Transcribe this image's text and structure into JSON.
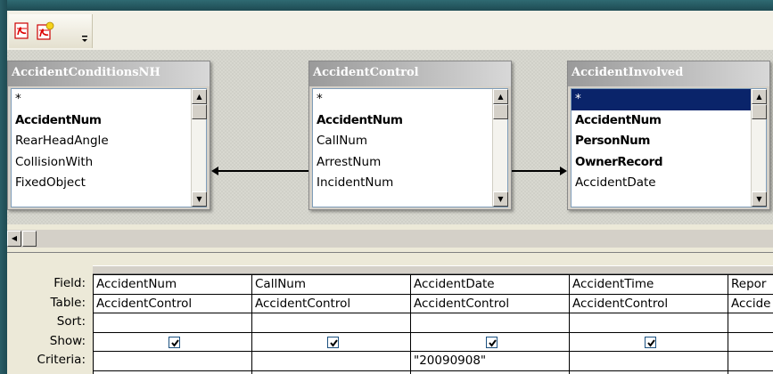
{
  "toolbar": {
    "buttons": [
      {
        "icon": "pdf-export-icon"
      },
      {
        "icon": "pdf-export-options-icon"
      }
    ],
    "overflow_icon": "toolbar-overflow-icon"
  },
  "tables": [
    {
      "title": "AccidentConditionsNH",
      "fields": [
        {
          "name": "*",
          "bold": false
        },
        {
          "name": "AccidentNum",
          "bold": true
        },
        {
          "name": "RearHeadAngle",
          "bold": false
        },
        {
          "name": "CollisionWith",
          "bold": false
        },
        {
          "name": "FixedObject",
          "bold": false
        }
      ]
    },
    {
      "title": "AccidentControl",
      "fields": [
        {
          "name": "*",
          "bold": false
        },
        {
          "name": "AccidentNum",
          "bold": true
        },
        {
          "name": "CallNum",
          "bold": false
        },
        {
          "name": "ArrestNum",
          "bold": false
        },
        {
          "name": "IncidentNum",
          "bold": false
        }
      ]
    },
    {
      "title": "AccidentInvolved",
      "fields": [
        {
          "name": "*",
          "bold": false,
          "selected": true
        },
        {
          "name": "AccidentNum",
          "bold": true
        },
        {
          "name": "PersonNum",
          "bold": true
        },
        {
          "name": "OwnerRecord",
          "bold": true
        },
        {
          "name": "AccidentDate",
          "bold": false
        }
      ]
    }
  ],
  "grid": {
    "row_labels": [
      "Field:",
      "Table:",
      "Sort:",
      "Show:",
      "Criteria:"
    ],
    "columns": [
      {
        "field": "AccidentNum",
        "table": "AccidentControl",
        "sort": "",
        "show": true,
        "criteria": ""
      },
      {
        "field": "CallNum",
        "table": "AccidentControl",
        "sort": "",
        "show": true,
        "criteria": ""
      },
      {
        "field": "AccidentDate",
        "table": "AccidentControl",
        "sort": "",
        "show": true,
        "criteria": "\"20090908\""
      },
      {
        "field": "AccidentTime",
        "table": "AccidentControl",
        "sort": "",
        "show": true,
        "criteria": ""
      },
      {
        "field": "Repor",
        "table": "Accide",
        "sort": "",
        "show": null,
        "criteria": ""
      }
    ]
  },
  "colors": {
    "selection": "#0a246a",
    "window_bg": "#ece9d8",
    "frame": "#1e4a52"
  }
}
